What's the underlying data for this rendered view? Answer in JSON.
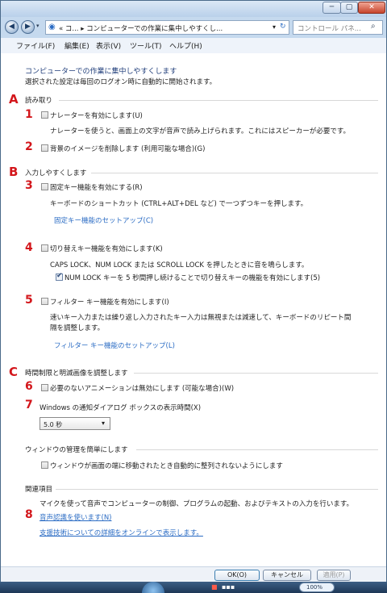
{
  "window": {
    "min_icon": "minimize-icon",
    "max_icon": "maximize-icon",
    "close_icon": "close-icon"
  },
  "address": {
    "back_icon": "back-arrow-icon",
    "forward_icon": "forward-arrow-icon",
    "prefix": "«  コ...  ▸  コンピューターでの作業に集中しやすくし...",
    "search_placeholder": "コントロール パネ..."
  },
  "menu": [
    "ファイル(F)",
    "編集(E)",
    "表示(V)",
    "ツール(T)",
    "ヘルプ(H)"
  ],
  "header": {
    "title": "コンピューターでの作業に集中しやすくします",
    "subtitle": "選択された設定は毎回のログオン時に自動的に開始されます。"
  },
  "markers": {
    "A": "A",
    "B": "B",
    "C": "C",
    "n1": "1",
    "n2": "2",
    "n3": "3",
    "n4": "4",
    "n5": "5",
    "n6": "6",
    "n7": "7",
    "n8": "8"
  },
  "sections": {
    "reading": "読み取り",
    "input": "入力しやすくします",
    "timing": "時間制限と明滅画像を調整します",
    "window_mgmt": "ウィンドウの管理を簡単にします",
    "related": "関連項目"
  },
  "options": {
    "narrator": {
      "label": "ナレーターを有効にします(U)",
      "desc": "ナレーターを使うと、画面上の文字が音声で読み上げられます。これにはスピーカーが必要です。"
    },
    "background": {
      "label": "背景のイメージを削除します (利用可能な場合)(G)"
    },
    "sticky": {
      "label": "固定キー機能を有効にする(R)",
      "desc": "キーボードのショートカット (CTRL+ALT+DEL など) で一つずつキーを押します。",
      "link": "固定キー機能のセットアップ(C)"
    },
    "toggle": {
      "label": "切り替えキー機能を有効にします(K)",
      "desc": "CAPS LOCK、NUM LOCK または SCROLL LOCK を押したときに音を鳴らします。",
      "sub": "NUM LOCK キーを 5 秒間押し続けることで切り替えキーの機能を有効にします(5)"
    },
    "filter": {
      "label": "フィルター キー機能を有効にします(I)",
      "desc1": "速いキー入力または繰り返し入力されたキー入力は無視または減速して、キーボードのリピート間",
      "desc2": "隔を調整します。",
      "link": "フィルター キー機能のセットアップ(L)"
    },
    "animation": {
      "label": "必要のないアニメーションは無効にします (可能な場合)(W)"
    },
    "notify": {
      "label": "Windows の通知ダイアログ ボックスの表示時間(X)",
      "value": "5.0 秒"
    },
    "snap": {
      "label": "ウィンドウが画面の端に移動されたとき自動的に整列されないようにします"
    }
  },
  "related": {
    "desc": "マイクを使って音声でコンピューターの制御、プログラムの起動、およびテキストの入力を行います。",
    "link1": "音声認識を使います(N)",
    "link2": "支援技術についての詳細をオンラインで表示します。"
  },
  "buttons": {
    "ok": "OK(O)",
    "cancel": "キャンセル",
    "apply": "適用(P)"
  },
  "taskbar": {
    "zoom": "100%"
  }
}
